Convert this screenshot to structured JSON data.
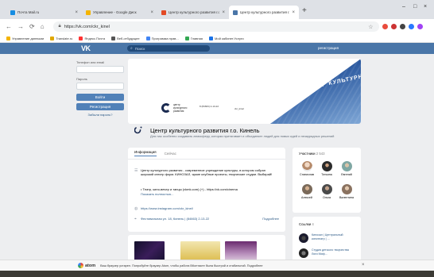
{
  "browser": {
    "tabs": [
      {
        "title": "Почта Mail.ru",
        "favicon_color": "#168de2"
      },
      {
        "title": "Управление - Google Диск",
        "favicon_color": "#f4b400"
      },
      {
        "title": "Центр культурного развития г.о.",
        "favicon_color": "#e34a26"
      },
      {
        "title": "Центр культурного развития г.о.",
        "favicon_color": "#4a76a8"
      }
    ],
    "new_tab": "+",
    "url": "https://vk.com/ckr_kinel",
    "bookmarks": [
      {
        "label": "Управление данными",
        "color": "#f4b400"
      },
      {
        "label": "Translate.ru",
        "color": "#e0a800"
      },
      {
        "label": "Яндекс.Почта",
        "color": "#ff3333"
      },
      {
        "label": "Веб-отбудущее",
        "color": "#555"
      },
      {
        "label": "Программа прав...",
        "color": "#4285f4"
      },
      {
        "label": "Главная",
        "color": "#34a853"
      },
      {
        "label": "Мой кабинет.Услуги",
        "color": "#1a73e8"
      }
    ],
    "extensions": [
      "#e94c3d",
      "#d44",
      "#e94c3d",
      "#2979ff",
      "#a142f4"
    ]
  },
  "vk": {
    "logo": "VK",
    "search_placeholder": "Поиск",
    "register": "регистрация"
  },
  "login": {
    "phone_label": "Телефон или email",
    "password_label": "Пароль",
    "login_button": "Войти",
    "register_button": "Регистрация",
    "forgot": "Забыли пароль?"
  },
  "group": {
    "cover_text": "ЦЕНТР КУЛЬТУРНОГО РАЗВИТИЯ",
    "cover_logo_text": "центр культурного развития",
    "cover_phone": "8 (84663) 2-13-22",
    "cover_small": "ckr_kinel",
    "name": "Центр культурного развития г.о. Кинель",
    "description": "Для нас особенно создавать атмосферу, которая притягивает и объединяет людей для новых идей и незаурядных решений"
  },
  "info": {
    "tab_info": "Информация",
    "tab_goods": "Сейчас",
    "about": "Центр культурного развития - современное учреждение культуры, в котором собран широкий спектр форм. КИНОЗАЛ, яркие клубные проекты, творческие студии. Выбирай!",
    "link_line": "• Театр, кино-вечер и танцы (vkmk.com) (+) - https://vk.com/cinema",
    "show_more": "Показать полностью...",
    "website": "https://www.instagram.com/ckr_kinel/",
    "address": "Фестивальная ул. 18, Кинель | (84663) 2-13-22",
    "more": "Подробнее"
  },
  "members": {
    "title": "Участники",
    "count": "2 543",
    "people": [
      {
        "name": "Станислав",
        "color": "#b58a6a"
      },
      {
        "name": "Татьяна",
        "color": "#2b2b2b"
      },
      {
        "name": "Евгений",
        "color": "#7fa7a3"
      },
      {
        "name": "Алексей",
        "color": "#7a6a5a"
      },
      {
        "name": "Ольга",
        "color": "#4a4a4a"
      },
      {
        "name": "Валентина",
        "color": "#8a7260"
      }
    ]
  },
  "links": {
    "title": "Ссылки",
    "count": "4",
    "items": [
      {
        "text": "Кинозал | Центральный кинотеатр | ...",
        "color": "#1b1b2e"
      },
      {
        "text": "Студия детского творчества Лиги Миф...",
        "color": "#222"
      }
    ]
  },
  "notice": {
    "brand": "atom",
    "text": "Ваш браузер устарел. Попробуйте браузер Atom, чтобы работа ВКонтакте была быстрой и стабильной. Подробнее",
    "close": "×"
  },
  "thumbs": [
    {
      "label": "FESTIVAL",
      "color": "#3a1d5a"
    },
    {
      "label": "ФЕСТИВАЛЬНЫЙ",
      "color": "#d8b43a"
    },
    {
      "label": "ART",
      "color": "#b48ab8"
    }
  ]
}
